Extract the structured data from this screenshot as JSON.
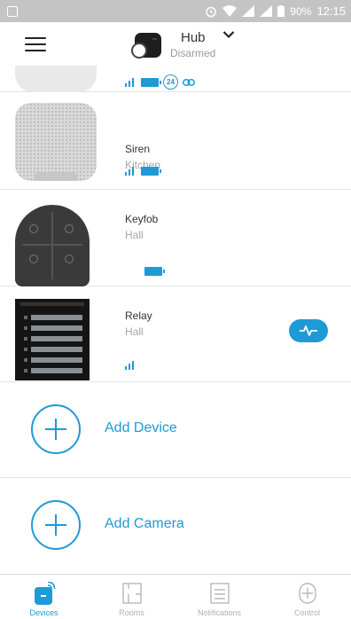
{
  "status_bar": {
    "battery": "90%",
    "time": "12:15"
  },
  "header": {
    "hub_name": "Hub",
    "hub_status": "Disarmed"
  },
  "devices": [
    {
      "name": "Siren",
      "room": "Kitchen"
    },
    {
      "name": "Keyfob",
      "room": "Hall"
    },
    {
      "name": "Relay",
      "room": "Hall"
    }
  ],
  "top_device": {
    "badge": "24"
  },
  "add_actions": {
    "device": "Add Device",
    "camera": "Add Camera"
  },
  "nav": {
    "devices": "Devices",
    "rooms": "Rooms",
    "notifications": "Notifications",
    "control": "Control",
    "active": "Devices"
  },
  "colors": {
    "accent": "#1e9ad6",
    "status_bar": "#c4c4c4"
  }
}
